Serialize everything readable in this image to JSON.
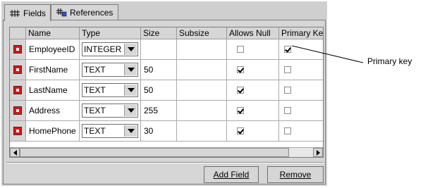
{
  "tabs": [
    {
      "label": "Fields",
      "icon": "fields-icon"
    },
    {
      "label": "References",
      "icon": "references-icon"
    }
  ],
  "table": {
    "columns": [
      "Name",
      "Type",
      "Size",
      "Subsize",
      "Allows Null",
      "Primary Ke"
    ],
    "rows": [
      {
        "name": "EmployeeID",
        "type": "INTEGER",
        "size": "",
        "subsize": "",
        "allows_null": false,
        "primary_key": true
      },
      {
        "name": "FirstName",
        "type": "TEXT",
        "size": "50",
        "subsize": "",
        "allows_null": true,
        "primary_key": false
      },
      {
        "name": "LastName",
        "type": "TEXT",
        "size": "50",
        "subsize": "",
        "allows_null": true,
        "primary_key": false
      },
      {
        "name": "Address",
        "type": "TEXT",
        "size": "255",
        "subsize": "",
        "allows_null": true,
        "primary_key": false
      },
      {
        "name": "HomePhone",
        "type": "TEXT",
        "size": "30",
        "subsize": "",
        "allows_null": true,
        "primary_key": false
      }
    ]
  },
  "buttons": {
    "add_field": "Add Field",
    "remove": "Remove"
  },
  "callout": {
    "label": "Primary key"
  }
}
